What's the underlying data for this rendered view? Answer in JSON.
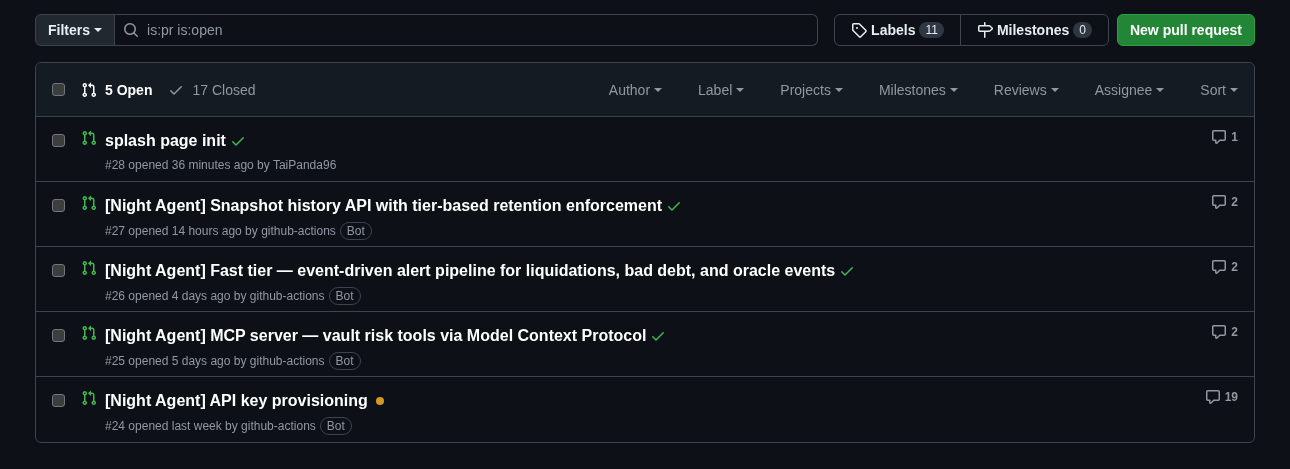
{
  "toolbar": {
    "filter_button": "Filters",
    "search": {
      "value": "is:pr is:open"
    },
    "labels": {
      "label": "Labels",
      "count": "11"
    },
    "milestones": {
      "label": "Milestones",
      "count": "0"
    },
    "new_button": "New pull request"
  },
  "list": {
    "select_all": {
      "checked": false
    },
    "states": [
      {
        "label": "5 Open",
        "selected": true
      },
      {
        "label": "17 Closed",
        "selected": false
      }
    ],
    "filters": [
      "Author",
      "Label",
      "Projects",
      "Milestones",
      "Reviews",
      "Assignee",
      "Sort"
    ],
    "rows": [
      {
        "title": "splash page init",
        "kind": "success",
        "meta": "#28 opened 36 minutes ago by TaiPanda96",
        "comments": "1",
        "checked": false
      },
      {
        "title": "[Night Agent] Snapshot history API with tier-based retention enforcement",
        "kind": "success",
        "meta": "#27 opened 14 hours ago by github-actions",
        "badge": "Bot",
        "comments": "2",
        "checked": false
      },
      {
        "title": "[Night Agent] Fast tier — event-driven alert pipeline for liquidations, bad debt, and oracle events",
        "kind": "success",
        "meta": "#26 opened 4 days ago by github-actions",
        "badge": "Bot",
        "comments": "2",
        "checked": false
      },
      {
        "title": "[Night Agent] MCP server — vault risk tools via Model Context Protocol",
        "kind": "success",
        "meta": "#25 opened 5 days ago by github-actions",
        "badge": "Bot",
        "comments": "2",
        "checked": false
      },
      {
        "title": "[Night Agent] API key provisioning",
        "kind": "pending",
        "meta": "#24 opened last week by github-actions",
        "badge": "Bot",
        "comments": "19",
        "checked": false
      }
    ]
  }
}
